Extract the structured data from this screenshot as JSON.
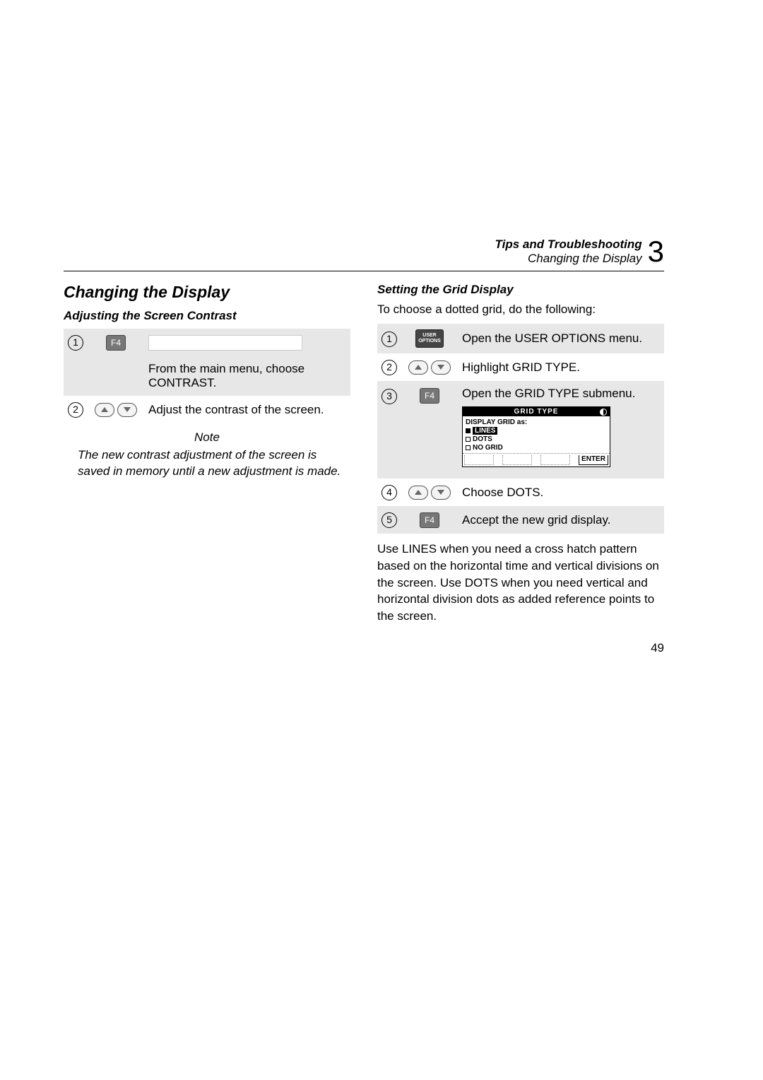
{
  "header": {
    "top": "Tips and Troubleshooting",
    "sub": "Changing the Display",
    "chapter": "3"
  },
  "left": {
    "title": "Changing the Display",
    "subtitle": "Adjusting the Screen Contrast",
    "steps": [
      {
        "num": "1",
        "icon": "f4",
        "icon_label": "F4",
        "desc": ""
      },
      {
        "num": "",
        "icon": "",
        "icon_label": "",
        "desc": "From the main menu, choose CONTRAST."
      },
      {
        "num": "2",
        "icon": "arrows",
        "desc": "Adjust the contrast of the screen."
      }
    ],
    "note_label": "Note",
    "note": "The new contrast adjustment of the screen is saved in memory until a new adjustment is made."
  },
  "right": {
    "subtitle": "Setting the Grid Display",
    "intro": "To choose a dotted grid, do the following:",
    "steps": [
      {
        "num": "1",
        "icon": "user",
        "icon_label": "USER OPTIONS",
        "desc": "Open the USER OPTIONS menu."
      },
      {
        "num": "2",
        "icon": "arrows",
        "desc": "Highlight GRID TYPE."
      },
      {
        "num": "3",
        "icon": "f4",
        "icon_label": "F4",
        "desc": "Open the GRID TYPE submenu."
      },
      {
        "num": "4",
        "icon": "arrows",
        "desc": "Choose DOTS."
      },
      {
        "num": "5",
        "icon": "f4",
        "icon_label": "F4",
        "desc": "Accept the new grid display."
      }
    ],
    "lcd": {
      "title": "GRID TYPE",
      "heading": "DISPLAY GRID as:",
      "options": [
        {
          "label": "LINES",
          "selected": true
        },
        {
          "label": "DOTS",
          "selected": false
        },
        {
          "label": "NO GRID",
          "selected": false
        }
      ],
      "enter": "ENTER"
    },
    "body": "Use LINES when you need a cross hatch pattern based on the horizontal time and vertical divisions on the screen. Use DOTS when you need vertical and horizontal division dots as added reference points to the screen."
  },
  "page_number": "49"
}
